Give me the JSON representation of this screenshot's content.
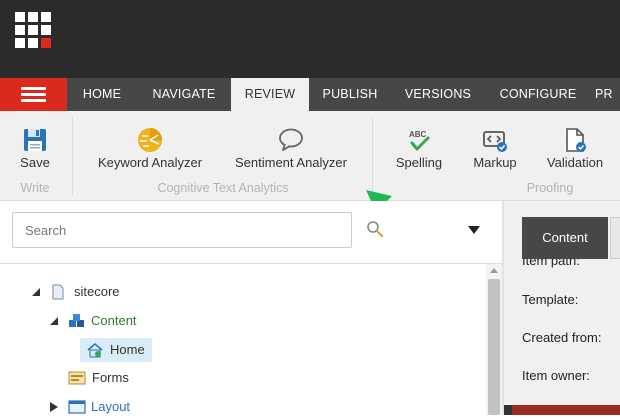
{
  "header": {
    "tabs": [
      {
        "label": "HOME"
      },
      {
        "label": "NAVIGATE"
      },
      {
        "label": "REVIEW",
        "active": true
      },
      {
        "label": "PUBLISH"
      },
      {
        "label": "VERSIONS"
      },
      {
        "label": "CONFIGURE"
      },
      {
        "label": "PR"
      }
    ]
  },
  "ribbon": {
    "buttons": [
      {
        "label": "Save",
        "icon": "save-icon"
      },
      {
        "label": "Keyword Analyzer",
        "icon": "keyword-analyzer-icon"
      },
      {
        "label": "Sentiment Analyzer",
        "icon": "speech-bubble-icon"
      },
      {
        "label": "Spelling",
        "icon": "spelling-check-icon"
      },
      {
        "label": "Markup",
        "icon": "markup-check-icon"
      },
      {
        "label": "Validation",
        "icon": "validation-document-icon"
      }
    ],
    "groups": [
      {
        "label": "Write"
      },
      {
        "label": "Cognitive Text Analytics"
      },
      {
        "label": "Proofing"
      }
    ]
  },
  "search": {
    "placeholder": "Search"
  },
  "tree": {
    "nodes": [
      {
        "label": "sitecore",
        "icon": "document-icon"
      },
      {
        "label": "Content",
        "icon": "content-cubes-icon"
      },
      {
        "label": "Home",
        "icon": "home-icon",
        "selected": true
      },
      {
        "label": "Forms",
        "icon": "forms-icon"
      },
      {
        "label": "Layout",
        "icon": "layout-icon"
      }
    ]
  },
  "editor": {
    "tab_content": "Content",
    "partial_label": "Item path:",
    "fields": [
      {
        "label": "Template:"
      },
      {
        "label": "Created from:"
      },
      {
        "label": "Item owner:"
      }
    ]
  },
  "colors": {
    "topbar": "#2b2b2b",
    "tabstrip": "#474747",
    "menu_red": "#dc291e",
    "ribbon_bg": "#f0f0f0",
    "accent_green": "#1db954"
  }
}
